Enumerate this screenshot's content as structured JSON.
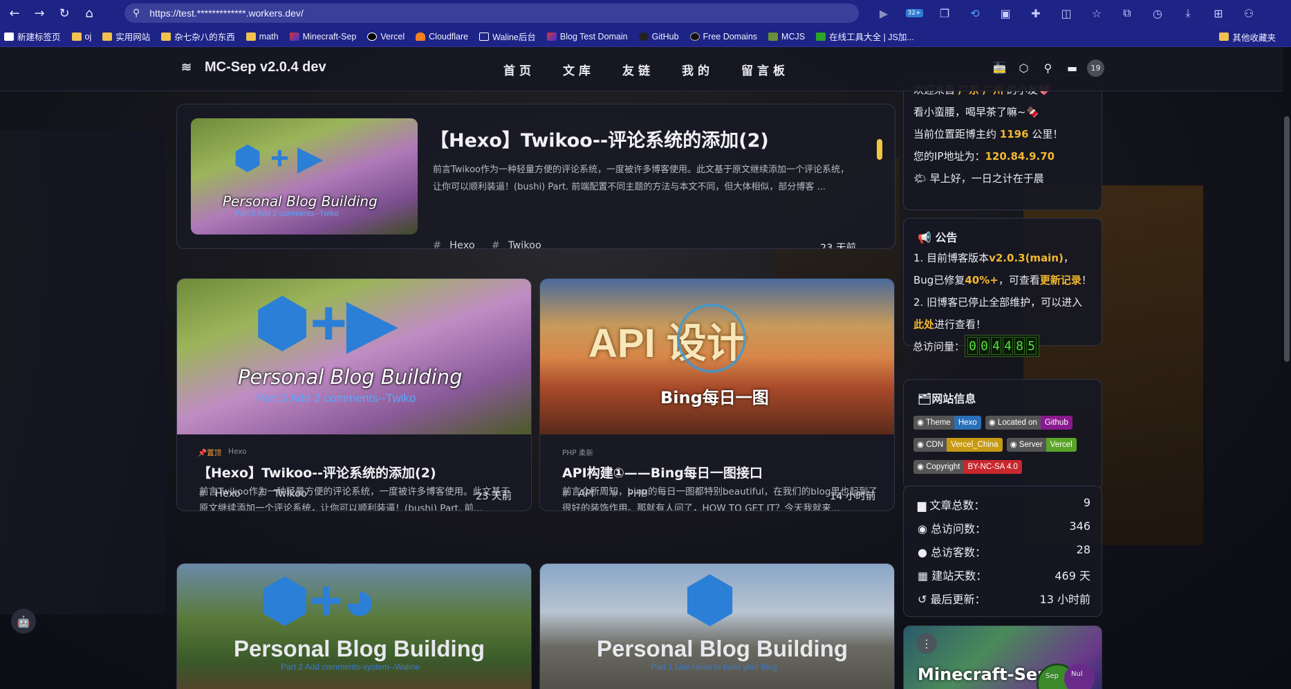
{
  "browser": {
    "url": "https://test.*************.workers.dev/",
    "nav_icons": [
      "back-icon",
      "forward-icon",
      "refresh-icon",
      "home-icon",
      "search-icon"
    ],
    "ext_badge": "32+",
    "bookmarks": [
      {
        "label": "新建标签页",
        "kind": "page"
      },
      {
        "label": "oj",
        "kind": "folder"
      },
      {
        "label": "实用网站",
        "kind": "folder"
      },
      {
        "label": "杂七杂八的东西",
        "kind": "folder"
      },
      {
        "label": "math",
        "kind": "folder"
      },
      {
        "label": "Minecraft-Sep",
        "kind": "site"
      },
      {
        "label": "Vercel",
        "kind": "site"
      },
      {
        "label": "Cloudflare",
        "kind": "site"
      },
      {
        "label": "Waline后台",
        "kind": "page"
      },
      {
        "label": "Blog Test Domain",
        "kind": "site"
      },
      {
        "label": "GitHub",
        "kind": "site"
      },
      {
        "label": "Free Domains",
        "kind": "site"
      },
      {
        "label": "MCJS",
        "kind": "site"
      },
      {
        "label": "在线工具大全 | JS加...",
        "kind": "site"
      }
    ],
    "other_bookmarks": "其他收藏夹"
  },
  "site": {
    "brand": "MC-Sep v2.0.4 dev",
    "nav": [
      "首页",
      "文库",
      "友链",
      "我的",
      "留言板"
    ],
    "notif_count": "19"
  },
  "featured": {
    "title": "【Hexo】Twikoo--评论系统的添加(2)",
    "excerpt": "前言Twikoo作为一种轻量方便的评论系统，一度被许多博客使用。此文基于原文继续添加一个评论系统，让你可以顺利装逼！(bushi) Part. 前端配置不同主题的方法与本文不同，但大体相似，部分博客 ...",
    "tags": [
      "Hexo",
      "Twikoo"
    ],
    "time": "23 天前",
    "thumb_title": "Personal Blog Building",
    "thumb_sub": "Part.3 Add 2 comments--Twiko"
  },
  "posts": [
    {
      "pin": "置顶",
      "category": "Hexo",
      "title": "【Hexo】Twikoo--评论系统的添加(2)",
      "excerpt": "前言Twikoo作为一种轻量方便的评论系统，一度被许多博客使用。此文基于原文继续添加一个评论系统，让你可以顺利装逼！(bushi) Part. 前...",
      "tags": [
        "Hexo",
        "Twikoo"
      ],
      "time": "23 天前",
      "thumb_title": "Personal Blog Building",
      "thumb_sub": "Part.3 Add 2 comments--Twiko"
    },
    {
      "pin": "",
      "category": "PHP  柔新",
      "title": "API构建①——Bing每日一图接口",
      "excerpt": "前言众所周知，bing的每日一图都特别beautiful，在我们的blog里也起到了很好的装饰作用。那就有人问了，HOW TO GET IT？今天我就来...",
      "tags": [
        "API",
        "PHP"
      ],
      "time": "14 小时前",
      "thumb_title": "API 设计",
      "thumb_sub": "Bing每日一图"
    },
    {
      "thumb_title": "Personal Blog Building",
      "thumb_sub": "Part.2 Add comments-system--Waline"
    },
    {
      "thumb_title": "Personal Blog Building",
      "thumb_sub": "Part.1 Use Hexo to build your blog"
    }
  ],
  "welcome": {
    "l1a": "欢迎来自",
    "l1b": "广东 广州",
    "l1c": "的小友💖",
    "l2": "看小蛮腰，喝早茶了嘛~🍫",
    "l3a": "当前位置距博主约",
    "l3b": "1196",
    "l3c": "公里！",
    "l4a": "您的IP地址为：",
    "l4b": "120.84.9.70",
    "l5": "🌤 早上好，一日之计在于晨"
  },
  "notice": {
    "title": "公告",
    "l1a": "1. 目前博客版本",
    "l1b": "v2.0.3(main)",
    "l1c": "，",
    "l2a": "Bug已修复",
    "l2b": "40%+",
    "l2c": "，可查看",
    "l2d": "更新记录",
    "l2e": "！",
    "l3": "2. 旧博客已停止全部维护，可以进入",
    "l4a": "此处",
    "l4b": "进行查看！",
    "visits_label": "总访问量：",
    "visits": "004485"
  },
  "siteinfo": {
    "title": "网站信息",
    "shields": [
      {
        "l": "Theme",
        "r": "Hexo",
        "color": "#2b6fb8"
      },
      {
        "l": "Located on",
        "r": "Github",
        "color": "#8a1a8f"
      },
      {
        "l": "CDN",
        "r": "Vercel_China",
        "color": "#c79a14"
      },
      {
        "l": "Server",
        "r": "Vercel",
        "color": "#5aa42a"
      },
      {
        "l": "Copyright",
        "r": "BY-NC-SA 4.0",
        "color": "#c7272d"
      }
    ]
  },
  "stats": [
    {
      "icon": "folder-icon",
      "label": "文章总数：",
      "value": "9"
    },
    {
      "icon": "eye-icon",
      "label": "总访问数：",
      "value": "346"
    },
    {
      "icon": "user-icon",
      "label": "总访客数：",
      "value": "28"
    },
    {
      "icon": "calendar-icon",
      "label": "建站天数：",
      "value": "469 天"
    },
    {
      "icon": "history-icon",
      "label": "最后更新：",
      "value": "13 小时前"
    }
  ],
  "mc_card": {
    "title": "Minecraft-Sep",
    "btn1": "Sep",
    "btn2": "Nul"
  }
}
